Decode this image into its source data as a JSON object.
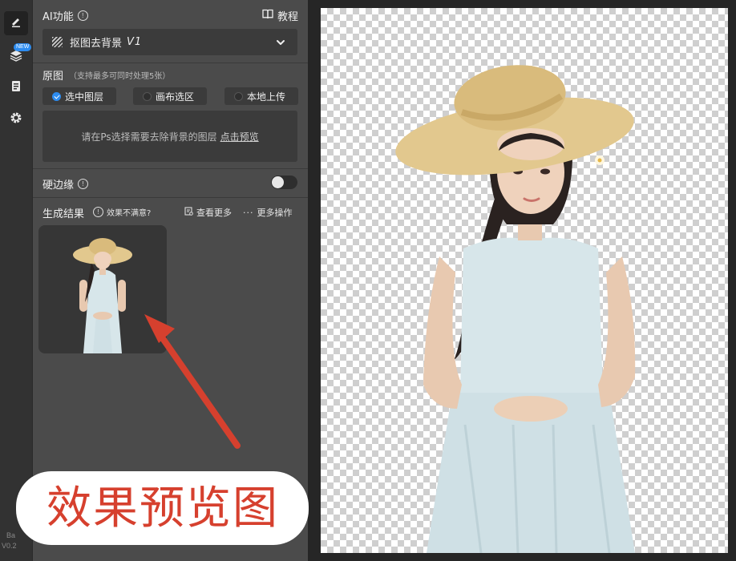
{
  "rail": {
    "items": [
      {
        "icon": "pen-edit-icon",
        "active": true
      },
      {
        "icon": "layers-icon",
        "badge": "NEW"
      },
      {
        "icon": "clipboard-icon"
      },
      {
        "icon": "gear-icon"
      }
    ],
    "version_line1": "Ba",
    "version_line2": "V0.2"
  },
  "ai_section": {
    "title": "AI功能",
    "tutorial_label": "教程",
    "selected_function": "抠图去背景",
    "selected_version": "V1"
  },
  "source_section": {
    "title": "原图",
    "hint": "（支持最多可同时处理5张）",
    "options": [
      {
        "label": "选中图层",
        "selected": true
      },
      {
        "label": "画布选区",
        "selected": false
      },
      {
        "label": "本地上传",
        "selected": false
      }
    ],
    "drop_hint": "请在Ps选择需要去除背景的图层",
    "preview_link": "点击预览"
  },
  "hard_edge": {
    "label": "硬边缘",
    "enabled": false
  },
  "results": {
    "title": "生成结果",
    "unsatisfied_label": "效果不满意?",
    "view_more_label": "查看更多",
    "more_actions_label": "更多操作"
  },
  "annotation": {
    "caption": "效果预览图",
    "color": "#d6402e"
  },
  "colors": {
    "accent": "#2d8cf0",
    "panel": "#4b4b4b",
    "control": "#3b3b3b"
  }
}
